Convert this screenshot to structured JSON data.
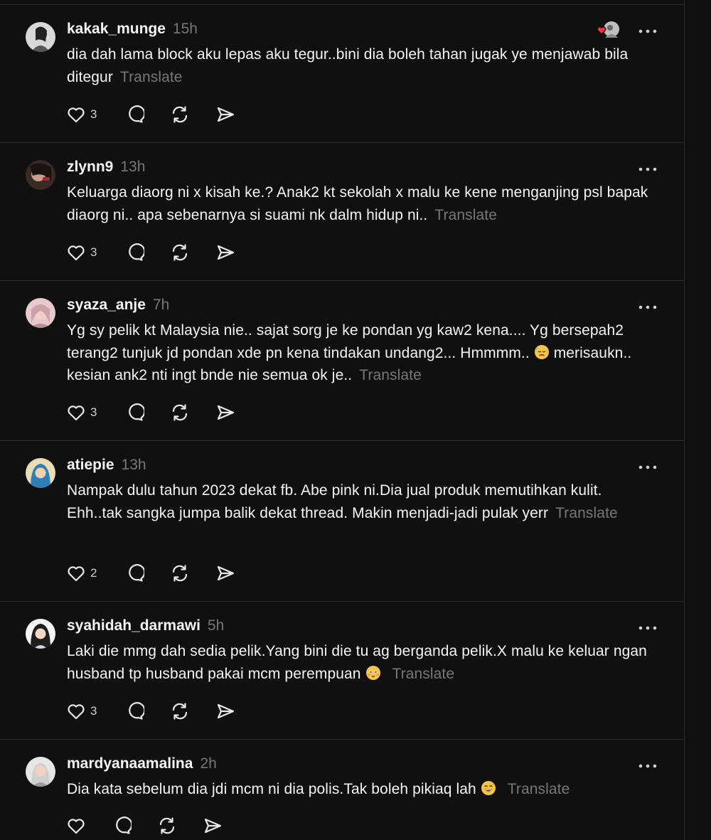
{
  "translate_label": "Translate",
  "colors": {
    "background": "#101010",
    "text": "#f3f5f7",
    "muted": "#777777",
    "heart_red": "#ff3040",
    "divider": "#2e2e2e"
  },
  "posts": [
    {
      "username": "kakak_munge",
      "time": "15h",
      "text": "dia dah lama block aku lepas aku tegur..bini dia boleh tahan jugak ye menjawab bila ditegur",
      "emoji": "",
      "likes": "3",
      "liked_by_author_badge": true
    },
    {
      "username": "zlynn9",
      "time": "13h",
      "text": "Keluarga diaorg ni x kisah ke.? Anak2 kt sekolah x malu ke kene menganjing psl bapak diaorg ni.. apa sebenarnya si suami nk dalm hidup ni..",
      "emoji": "",
      "likes": "3",
      "liked_by_author_badge": false
    },
    {
      "username": "syaza_anje",
      "time": "7h",
      "text_before": "Yg sy pelik kt Malaysia nie.. sajat sorg je ke pondan yg kaw2 kena.... Yg bersepah2 terang2 tunjuk jd pondan xde pn kena tindakan undang2... Hmmmm..",
      "text_after": "merisaukn.. kesian ank2 nti ingt bnde nie semua ok je..",
      "emoji": "downcast-sweat-face",
      "likes": "3",
      "liked_by_author_badge": false
    },
    {
      "username": "atiepie",
      "time": "13h",
      "text": "Nampak dulu tahun 2023 dekat fb. Abe pink ni.Dia jual produk memutihkan kulit. Ehh..tak sangka jumpa balik dekat thread. Makin menjadi-jadi pulak yerr",
      "emoji": "",
      "likes": "2",
      "liked_by_author_badge": false
    },
    {
      "username": "syahidah_darmawi",
      "time": "5h",
      "text": "Laki die mmg dah sedia pelik.Yang bini die tu ag berganda pelik.X malu ke keluar ngan husband tp husband pakai mcm perempuan",
      "emoji": "flushed-face",
      "likes": "3",
      "liked_by_author_badge": false
    },
    {
      "username": "mardyanaamalina",
      "time": "2h",
      "text": "Dia kata sebelum dia jdi mcm ni dia polis.Tak boleh pikiaq lah",
      "emoji": "grinning-sweat-face",
      "likes": "",
      "liked_by_author_badge": false
    }
  ]
}
